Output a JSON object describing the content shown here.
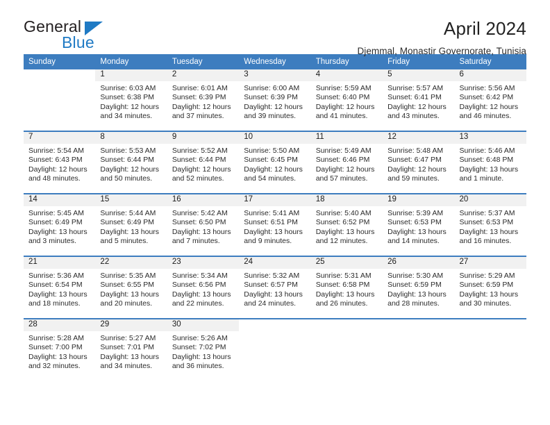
{
  "brand": {
    "name_part1": "General",
    "name_part2": "Blue",
    "blue": "#1f7ac4",
    "dark": "#231f20"
  },
  "header": {
    "title": "April 2024",
    "subtitle": "Djemmal, Monastir Governorate, Tunisia"
  },
  "theme": {
    "header_bg": "#3d7dbf",
    "header_text": "#ffffff",
    "daynum_bg": "#f1f1f1",
    "divider": "#3d7dbf"
  },
  "weekday_headers": [
    "Sunday",
    "Monday",
    "Tuesday",
    "Wednesday",
    "Thursday",
    "Friday",
    "Saturday"
  ],
  "labels": {
    "sunrise_prefix": "Sunrise:",
    "sunset_prefix": "Sunset:",
    "daylight_prefix": "Daylight:"
  },
  "weeks": [
    [
      {
        "day": "",
        "sunrise": "",
        "sunset": "",
        "daylight_line1": "",
        "daylight_line2": "",
        "empty": true,
        "blank": true
      },
      {
        "day": "1",
        "sunrise": "Sunrise: 6:03 AM",
        "sunset": "Sunset: 6:38 PM",
        "daylight_line1": "Daylight: 12 hours",
        "daylight_line2": "and 34 minutes."
      },
      {
        "day": "2",
        "sunrise": "Sunrise: 6:01 AM",
        "sunset": "Sunset: 6:39 PM",
        "daylight_line1": "Daylight: 12 hours",
        "daylight_line2": "and 37 minutes."
      },
      {
        "day": "3",
        "sunrise": "Sunrise: 6:00 AM",
        "sunset": "Sunset: 6:39 PM",
        "daylight_line1": "Daylight: 12 hours",
        "daylight_line2": "and 39 minutes."
      },
      {
        "day": "4",
        "sunrise": "Sunrise: 5:59 AM",
        "sunset": "Sunset: 6:40 PM",
        "daylight_line1": "Daylight: 12 hours",
        "daylight_line2": "and 41 minutes."
      },
      {
        "day": "5",
        "sunrise": "Sunrise: 5:57 AM",
        "sunset": "Sunset: 6:41 PM",
        "daylight_line1": "Daylight: 12 hours",
        "daylight_line2": "and 43 minutes."
      },
      {
        "day": "6",
        "sunrise": "Sunrise: 5:56 AM",
        "sunset": "Sunset: 6:42 PM",
        "daylight_line1": "Daylight: 12 hours",
        "daylight_line2": "and 46 minutes."
      }
    ],
    [
      {
        "day": "7",
        "sunrise": "Sunrise: 5:54 AM",
        "sunset": "Sunset: 6:43 PM",
        "daylight_line1": "Daylight: 12 hours",
        "daylight_line2": "and 48 minutes."
      },
      {
        "day": "8",
        "sunrise": "Sunrise: 5:53 AM",
        "sunset": "Sunset: 6:44 PM",
        "daylight_line1": "Daylight: 12 hours",
        "daylight_line2": "and 50 minutes."
      },
      {
        "day": "9",
        "sunrise": "Sunrise: 5:52 AM",
        "sunset": "Sunset: 6:44 PM",
        "daylight_line1": "Daylight: 12 hours",
        "daylight_line2": "and 52 minutes."
      },
      {
        "day": "10",
        "sunrise": "Sunrise: 5:50 AM",
        "sunset": "Sunset: 6:45 PM",
        "daylight_line1": "Daylight: 12 hours",
        "daylight_line2": "and 54 minutes."
      },
      {
        "day": "11",
        "sunrise": "Sunrise: 5:49 AM",
        "sunset": "Sunset: 6:46 PM",
        "daylight_line1": "Daylight: 12 hours",
        "daylight_line2": "and 57 minutes."
      },
      {
        "day": "12",
        "sunrise": "Sunrise: 5:48 AM",
        "sunset": "Sunset: 6:47 PM",
        "daylight_line1": "Daylight: 12 hours",
        "daylight_line2": "and 59 minutes."
      },
      {
        "day": "13",
        "sunrise": "Sunrise: 5:46 AM",
        "sunset": "Sunset: 6:48 PM",
        "daylight_line1": "Daylight: 13 hours",
        "daylight_line2": "and 1 minute."
      }
    ],
    [
      {
        "day": "14",
        "sunrise": "Sunrise: 5:45 AM",
        "sunset": "Sunset: 6:49 PM",
        "daylight_line1": "Daylight: 13 hours",
        "daylight_line2": "and 3 minutes."
      },
      {
        "day": "15",
        "sunrise": "Sunrise: 5:44 AM",
        "sunset": "Sunset: 6:49 PM",
        "daylight_line1": "Daylight: 13 hours",
        "daylight_line2": "and 5 minutes."
      },
      {
        "day": "16",
        "sunrise": "Sunrise: 5:42 AM",
        "sunset": "Sunset: 6:50 PM",
        "daylight_line1": "Daylight: 13 hours",
        "daylight_line2": "and 7 minutes."
      },
      {
        "day": "17",
        "sunrise": "Sunrise: 5:41 AM",
        "sunset": "Sunset: 6:51 PM",
        "daylight_line1": "Daylight: 13 hours",
        "daylight_line2": "and 9 minutes."
      },
      {
        "day": "18",
        "sunrise": "Sunrise: 5:40 AM",
        "sunset": "Sunset: 6:52 PM",
        "daylight_line1": "Daylight: 13 hours",
        "daylight_line2": "and 12 minutes."
      },
      {
        "day": "19",
        "sunrise": "Sunrise: 5:39 AM",
        "sunset": "Sunset: 6:53 PM",
        "daylight_line1": "Daylight: 13 hours",
        "daylight_line2": "and 14 minutes."
      },
      {
        "day": "20",
        "sunrise": "Sunrise: 5:37 AM",
        "sunset": "Sunset: 6:53 PM",
        "daylight_line1": "Daylight: 13 hours",
        "daylight_line2": "and 16 minutes."
      }
    ],
    [
      {
        "day": "21",
        "sunrise": "Sunrise: 5:36 AM",
        "sunset": "Sunset: 6:54 PM",
        "daylight_line1": "Daylight: 13 hours",
        "daylight_line2": "and 18 minutes."
      },
      {
        "day": "22",
        "sunrise": "Sunrise: 5:35 AM",
        "sunset": "Sunset: 6:55 PM",
        "daylight_line1": "Daylight: 13 hours",
        "daylight_line2": "and 20 minutes."
      },
      {
        "day": "23",
        "sunrise": "Sunrise: 5:34 AM",
        "sunset": "Sunset: 6:56 PM",
        "daylight_line1": "Daylight: 13 hours",
        "daylight_line2": "and 22 minutes."
      },
      {
        "day": "24",
        "sunrise": "Sunrise: 5:32 AM",
        "sunset": "Sunset: 6:57 PM",
        "daylight_line1": "Daylight: 13 hours",
        "daylight_line2": "and 24 minutes."
      },
      {
        "day": "25",
        "sunrise": "Sunrise: 5:31 AM",
        "sunset": "Sunset: 6:58 PM",
        "daylight_line1": "Daylight: 13 hours",
        "daylight_line2": "and 26 minutes."
      },
      {
        "day": "26",
        "sunrise": "Sunrise: 5:30 AM",
        "sunset": "Sunset: 6:59 PM",
        "daylight_line1": "Daylight: 13 hours",
        "daylight_line2": "and 28 minutes."
      },
      {
        "day": "27",
        "sunrise": "Sunrise: 5:29 AM",
        "sunset": "Sunset: 6:59 PM",
        "daylight_line1": "Daylight: 13 hours",
        "daylight_line2": "and 30 minutes."
      }
    ],
    [
      {
        "day": "28",
        "sunrise": "Sunrise: 5:28 AM",
        "sunset": "Sunset: 7:00 PM",
        "daylight_line1": "Daylight: 13 hours",
        "daylight_line2": "and 32 minutes."
      },
      {
        "day": "29",
        "sunrise": "Sunrise: 5:27 AM",
        "sunset": "Sunset: 7:01 PM",
        "daylight_line1": "Daylight: 13 hours",
        "daylight_line2": "and 34 minutes."
      },
      {
        "day": "30",
        "sunrise": "Sunrise: 5:26 AM",
        "sunset": "Sunset: 7:02 PM",
        "daylight_line1": "Daylight: 13 hours",
        "daylight_line2": "and 36 minutes."
      },
      {
        "day": "",
        "sunrise": "",
        "sunset": "",
        "daylight_line1": "",
        "daylight_line2": "",
        "empty": true,
        "blank": true
      },
      {
        "day": "",
        "sunrise": "",
        "sunset": "",
        "daylight_line1": "",
        "daylight_line2": "",
        "empty": true,
        "blank": true
      },
      {
        "day": "",
        "sunrise": "",
        "sunset": "",
        "daylight_line1": "",
        "daylight_line2": "",
        "empty": true,
        "blank": true
      },
      {
        "day": "",
        "sunrise": "",
        "sunset": "",
        "daylight_line1": "",
        "daylight_line2": "",
        "empty": true,
        "blank": true
      }
    ]
  ]
}
